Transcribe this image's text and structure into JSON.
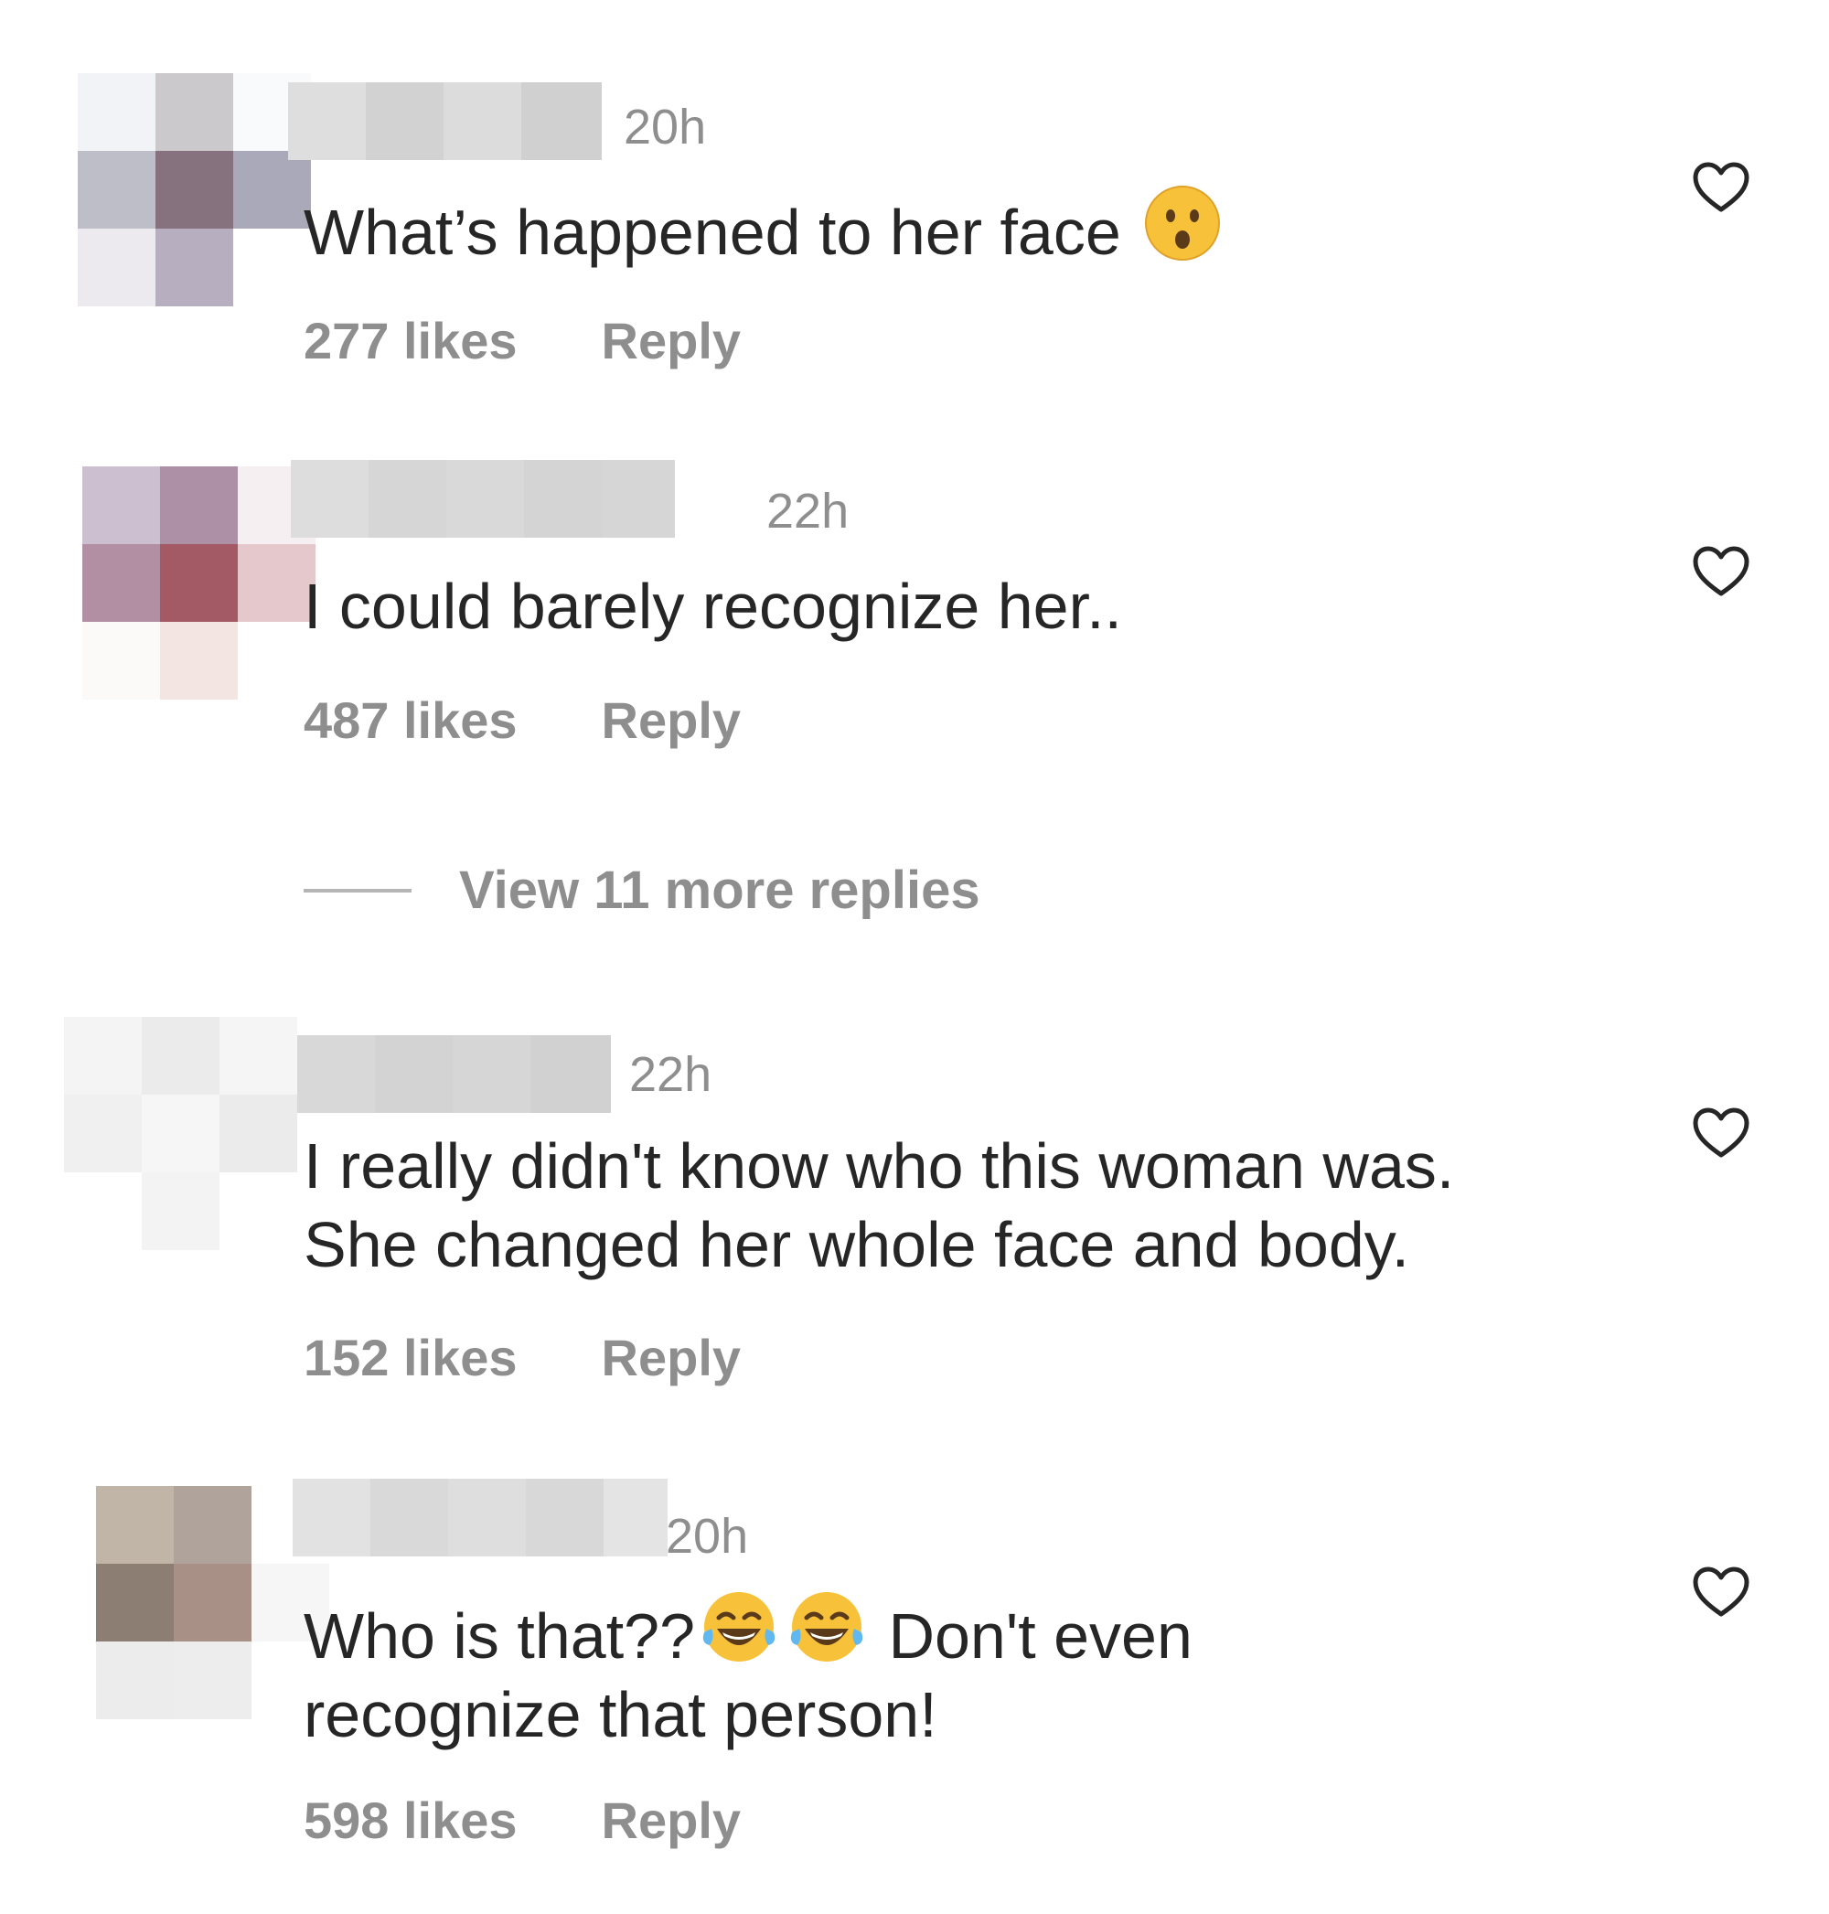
{
  "comments": [
    {
      "time": "20h",
      "text": "What’s happened to her face",
      "text_after": "",
      "likes": "277 likes",
      "reply": "Reply"
    },
    {
      "time": "22h",
      "text": "I could barely recognize her..",
      "likes": "487 likes",
      "reply": "Reply"
    },
    {
      "time": "22h",
      "text": "I really didn't know who this woman was.\nShe changed her whole face and body.",
      "likes": "152 likes",
      "reply": "Reply"
    },
    {
      "time": "20h",
      "text": "Who is that??",
      "text_after": " Don't even\nrecognize that person!",
      "likes": "598 likes",
      "reply": "Reply"
    }
  ],
  "view_more_replies": "View 11 more replies",
  "icons": {
    "like": "heart-outline-icon",
    "emoji_1": "astonished-face-emoji",
    "emoji_2": "tears-of-joy-emoji"
  },
  "colors": {
    "text": "#262626",
    "secondary": "#8e8e8e",
    "background": "#ffffff"
  }
}
